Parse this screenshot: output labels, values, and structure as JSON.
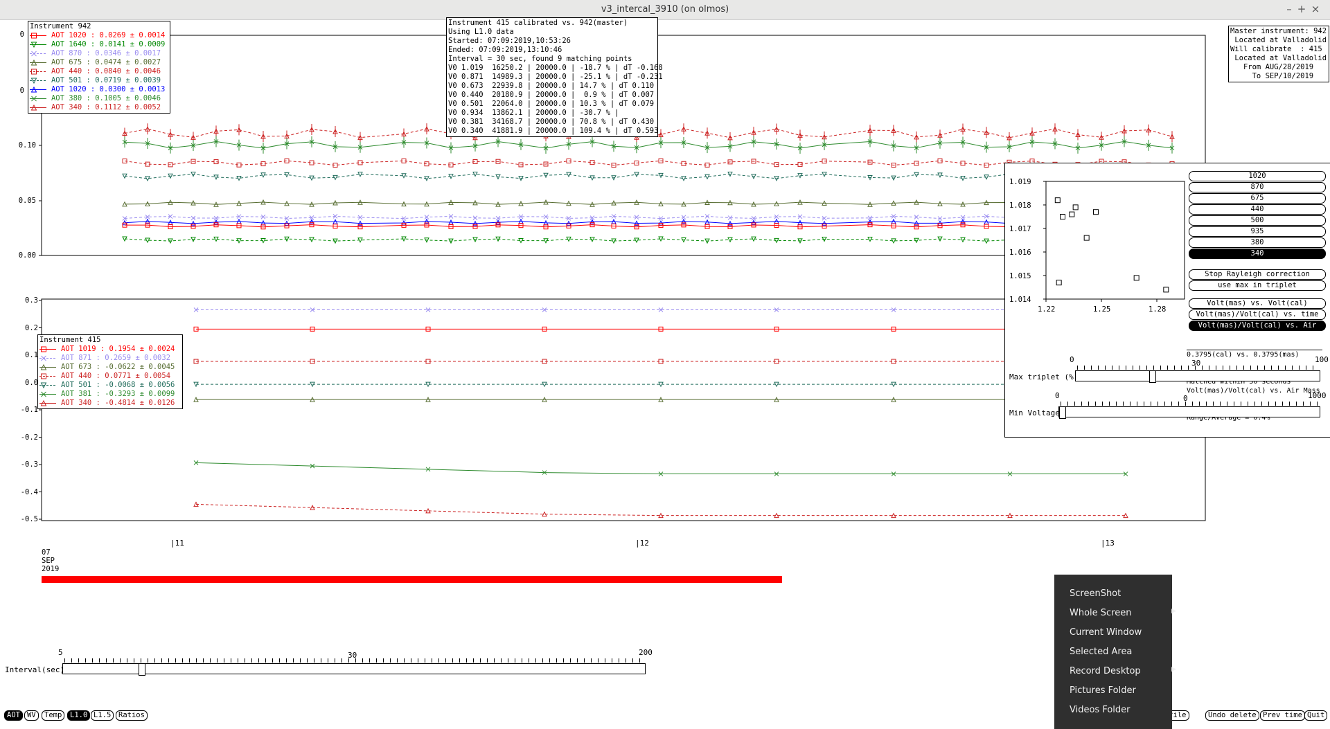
{
  "window": {
    "title": "v3_intercal_3910 (on olmos)",
    "min": "–",
    "max": "+",
    "close": "×"
  },
  "top_plot": {
    "y_ticks": [
      "0",
      "0",
      "0.10",
      "0.05",
      "0.00"
    ],
    "legend_title": "Instrument 942",
    "legend": [
      {
        "label": "AOT 1020 :",
        "value": "0.0269 ± 0.0014",
        "color": "#ff0000",
        "dash": false,
        "marker": "square"
      },
      {
        "label": "AOT 1640 :",
        "value": "0.0141 ± 0.0009",
        "color": "#008800",
        "dash": false,
        "marker": "tri-down"
      },
      {
        "label": "AOT 870 :",
        "value": "0.0346 ± 0.0017",
        "color": "#9a8cf0",
        "dash": true,
        "marker": "x"
      },
      {
        "label": "AOT 675 :",
        "value": "0.0474 ± 0.0027",
        "color": "#556b2f",
        "dash": false,
        "marker": "tri-up"
      },
      {
        "label": "AOT 440 :",
        "value": "0.0840 ± 0.0046",
        "color": "#cc2222",
        "dash": true,
        "marker": "square"
      },
      {
        "label": "AOT 501 :",
        "value": "0.0719 ± 0.0039",
        "color": "#1f6b5a",
        "dash": true,
        "marker": "tri-down"
      },
      {
        "label": "AOT 1020 :",
        "value": "0.0300 ± 0.0013",
        "color": "#0000ff",
        "dash": false,
        "marker": "tri-up"
      },
      {
        "label": "AOT 380 :",
        "value": "0.1005 ± 0.0046",
        "color": "#2e8b2e",
        "dash": false,
        "marker": "x"
      },
      {
        "label": "AOT 340 :",
        "value": "0.1112 ± 0.0052",
        "color": "#cc2222",
        "dash": false,
        "marker": "tri-up"
      }
    ]
  },
  "info_box": {
    "lines": [
      "Instrument 415 calibrated vs. 942(master)",
      "Using L1.0 data",
      "Started: 07:09:2019,10:53:26",
      "Ended: 07:09:2019,13:10:46",
      "Interval = 30 sec, found 9 matching points",
      "V0 1.019  16250.2 | 20000.0 | -18.7 % | dT -0.168",
      "V0 0.871  14989.3 | 20000.0 | -25.1 % | dT -0.231",
      "V0 0.673  22939.8 | 20000.0 | 14.7 % | dT 0.110",
      "V0 0.440  20180.9 | 20000.0 |  0.9 % | dT 0.007",
      "V0 0.501  22064.0 | 20000.0 | 10.3 % | dT 0.079",
      "V0 0.934  13862.1 | 20000.0 | -30.7 % |",
      "V0 0.381  34168.7 | 20000.0 | 70.8 % | dT 0.430",
      "V0 0.340  41881.9 | 20000.0 | 109.4 % | dT 0.593"
    ]
  },
  "master_box": {
    "lines": [
      "Master instrument: 942",
      " Located at Valladolid",
      "Will calibrate  : 415",
      " Located at Valladolid",
      "   From AUG/28/2019",
      "     To SEP/10/2019"
    ]
  },
  "bottom_plot": {
    "y_ticks": [
      "0.3",
      "0.2",
      "0.1",
      "0.0",
      "-0.1",
      "-0.2",
      "-0.3",
      "-0.4",
      "-0.5"
    ],
    "legend_title": "Instrument 415",
    "legend": [
      {
        "label": "AOT 1019 :",
        "value": "0.1954 ± 0.0024",
        "color": "#ff0000",
        "dash": false,
        "marker": "square"
      },
      {
        "label": "AOT 871 :",
        "value": "0.2659 ± 0.0032",
        "color": "#9a8cf0",
        "dash": true,
        "marker": "x"
      },
      {
        "label": "AOT 673 :",
        "value": "-0.0622 ± 0.0045",
        "color": "#556b2f",
        "dash": false,
        "marker": "tri-up"
      },
      {
        "label": "AOT 440 :",
        "value": "0.0771 ± 0.0054",
        "color": "#cc2222",
        "dash": true,
        "marker": "square"
      },
      {
        "label": "AOT 501 :",
        "value": "-0.0068 ± 0.0056",
        "color": "#1f6b5a",
        "dash": true,
        "marker": "tri-down"
      },
      {
        "label": "AOT 381 :",
        "value": "-0.3293 ± 0.0099",
        "color": "#2e8b2e",
        "dash": false,
        "marker": "x"
      },
      {
        "label": "AOT 340 :",
        "value": "-0.4814 ± 0.0126",
        "color": "#cc2222",
        "dash": false,
        "marker": "tri-up"
      }
    ]
  },
  "time_axis": {
    "ticks": [
      "11",
      "12",
      "13"
    ],
    "date_day": "07",
    "date_month": "SEP",
    "date_year": "2019"
  },
  "interval_slider": {
    "label": "Interval(sec)",
    "min": "5",
    "mid": "30",
    "max": "200",
    "value_fraction": 0.13
  },
  "control_panel": {
    "wavelength_buttons": [
      "1020",
      "870",
      "675",
      "440",
      "500",
      "935",
      "380",
      "340"
    ],
    "selected_wavelength": "340",
    "option_buttons": [
      "Stop Rayleigh correction",
      "use max in triplet"
    ],
    "plot_mode_buttons": [
      "Volt(mas) vs. Volt(cal)",
      "Volt(mas)/Volt(cal) vs. time",
      "Volt(mas)/Volt(cal) vs. Air Mass"
    ],
    "selected_plot_mode": "Volt(mas)/Volt(cal) vs. Air Mass",
    "scatter": {
      "y_ticks": [
        "1.019",
        "1.018",
        "1.017",
        "1.016",
        "1.015",
        "1.014"
      ],
      "x_ticks": [
        "1.22",
        "1.25",
        "1.28"
      ]
    },
    "max_triplet": {
      "label": "Max triplet (%)",
      "min": "0",
      "mid": "30",
      "max": "100",
      "value_fraction": 0.3
    },
    "min_voltage": {
      "label": "Min Voltage",
      "min": "0",
      "mid": "0",
      "max": "1000",
      "value_fraction": 0.0
    },
    "hidden_text": [
      "0.3795(cal) vs. 0.3795(mas)",
      "Matched within 30 seconds",
      "Volt(mas)/Volt(cal) vs. Air Mass",
      "Range/Average = 0.4%"
    ]
  },
  "bottom_buttons": {
    "left": [
      "AOT",
      "WV",
      "Temp",
      "L1.0",
      "L1.5",
      "Ratios"
    ],
    "selected": [
      "AOT",
      "L1.0"
    ],
    "right": [
      "Save into file",
      "Undo delete",
      "Prev time",
      "Quit"
    ]
  },
  "context_menu": {
    "items": [
      {
        "label": "ScreenShot",
        "submenu": false
      },
      {
        "label": "Whole Screen",
        "submenu": true
      },
      {
        "label": "Current Window",
        "submenu": false
      },
      {
        "label": "Selected Area",
        "submenu": false
      },
      {
        "label": "Record Desktop",
        "submenu": true
      },
      {
        "label": "Pictures Folder",
        "submenu": false
      },
      {
        "label": "Videos Folder",
        "submenu": false
      }
    ]
  }
}
